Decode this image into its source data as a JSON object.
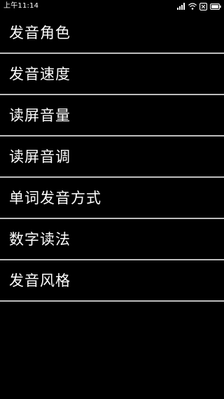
{
  "status_bar": {
    "time": "上午11:14",
    "icons": [
      "signal-icon",
      "wifi-icon",
      "sim-off-icon",
      "battery-icon"
    ]
  },
  "menu": {
    "items": [
      {
        "label": "发音角色"
      },
      {
        "label": "发音速度"
      },
      {
        "label": "读屏音量"
      },
      {
        "label": "读屏音调"
      },
      {
        "label": "单词发音方式"
      },
      {
        "label": "数字读法"
      },
      {
        "label": "发音风格"
      }
    ]
  },
  "colors": {
    "background": "#000000",
    "text": "#ffffff",
    "divider": "#bdbdbd"
  }
}
